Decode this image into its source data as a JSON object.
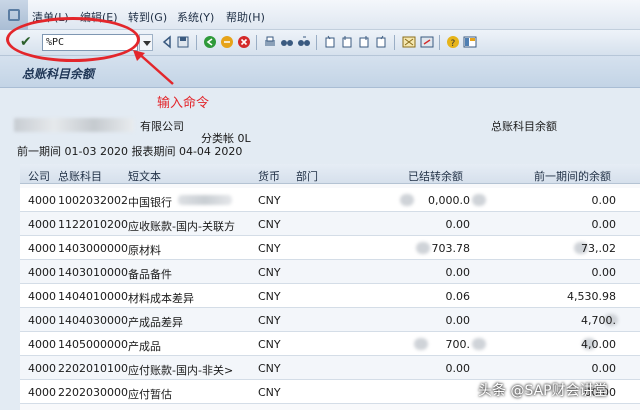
{
  "menubar": {
    "items": [
      "清单(L)",
      "编辑(E)",
      "转到(G)",
      "系统(Y)",
      "帮助(H)"
    ]
  },
  "toolbar": {
    "command_value": "%PC",
    "icons": [
      "check-icon",
      "back-icon",
      "save-icon",
      "back-nav-icon",
      "exit-icon",
      "cancel-icon",
      "print-icon",
      "find-icon",
      "find-next-icon",
      "first-page-icon",
      "prev-page-icon",
      "next-page-icon",
      "last-page-icon",
      "create-session-icon",
      "shortcut-icon",
      "help-icon",
      "layout-icon"
    ]
  },
  "page": {
    "title": "总账科目余额"
  },
  "annotation": {
    "text": "输入命令",
    "color": "#e3262b"
  },
  "report_header": {
    "company_suffix": "有限公司",
    "ledger": "分类帐 0L",
    "report_name": "总账科目余额",
    "period_line": "前一期间 01-03 2020 报表期间 04-04 2020"
  },
  "table": {
    "columns": [
      "公司",
      "总账科目",
      "短文本",
      "货币",
      "部门",
      "已结转余额",
      "前一期间的余额"
    ],
    "rows": [
      {
        "company": "4000",
        "account": "1002032002",
        "text": "中国银行",
        "currency": "CNY",
        "dept": "",
        "carry": "0,000.0",
        "prev": "0.00"
      },
      {
        "company": "4000",
        "account": "1122010200",
        "text": "应收账款-国内-关联方",
        "currency": "CNY",
        "dept": "",
        "carry": "0.00",
        "prev": "0.00"
      },
      {
        "company": "4000",
        "account": "1403000000",
        "text": "原材料",
        "currency": "CNY",
        "dept": "",
        "carry": "703.78",
        "prev": "73,.02"
      },
      {
        "company": "4000",
        "account": "1403010000",
        "text": "备品备件",
        "currency": "CNY",
        "dept": "",
        "carry": "0.00",
        "prev": "0.00"
      },
      {
        "company": "4000",
        "account": "1404010000",
        "text": "材料成本差异",
        "currency": "CNY",
        "dept": "",
        "carry": "0.06",
        "prev": "4,530.98"
      },
      {
        "company": "4000",
        "account": "1404030000",
        "text": "产成品差异",
        "currency": "CNY",
        "dept": "",
        "carry": "0.00",
        "prev": "4,700."
      },
      {
        "company": "4000",
        "account": "1405000000",
        "text": "产成品",
        "currency": "CNY",
        "dept": "",
        "carry": "700.",
        "prev": "4,0.00"
      },
      {
        "company": "4000",
        "account": "2202010100",
        "text": "应付账款-国内-非关>",
        "currency": "CNY",
        "dept": "",
        "carry": "0.00",
        "prev": "0.00"
      },
      {
        "company": "4000",
        "account": "2202030000",
        "text": "应付暂估",
        "currency": "CNY",
        "dept": "",
        "carry": "",
        "prev": "00.00"
      }
    ]
  },
  "watermark": "头条 @SAP财会讲堂"
}
